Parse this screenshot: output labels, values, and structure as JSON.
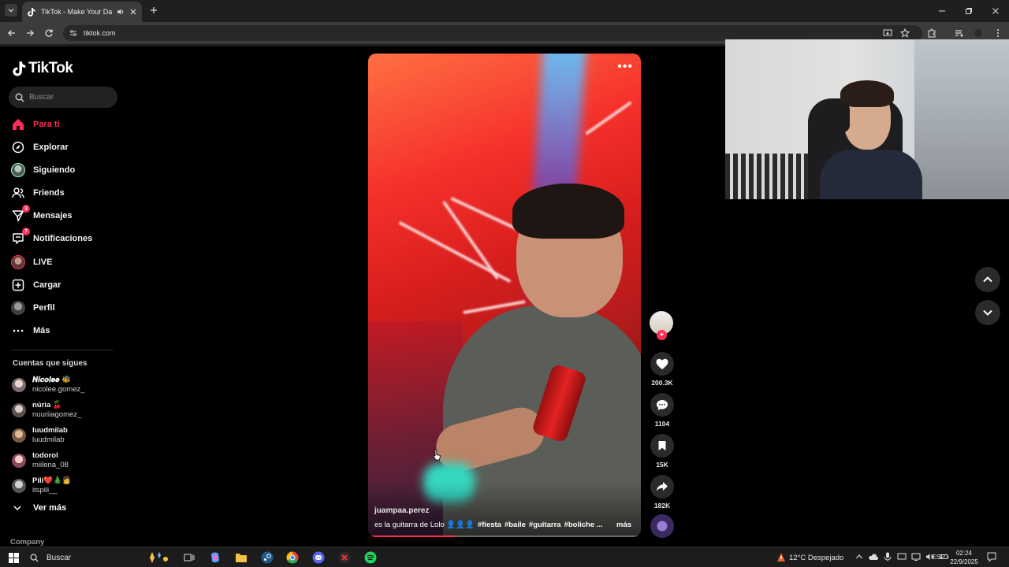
{
  "browser": {
    "tab_title": "TikTok - Make Your Day",
    "url": "tiktok.com"
  },
  "tiktok": {
    "brand": "TikTok",
    "search_placeholder": "Buscar",
    "menu": [
      {
        "label": "Para ti",
        "icon": "home-icon",
        "active": true
      },
      {
        "label": "Explorar",
        "icon": "compass-icon"
      },
      {
        "label": "Siguiendo",
        "icon": "following-avatar-icon"
      },
      {
        "label": "Friends",
        "icon": "friends-icon"
      },
      {
        "label": "Mensajes",
        "icon": "inbox-icon",
        "badge": "3"
      },
      {
        "label": "Notificaciones",
        "icon": "notification-icon",
        "badge": "7"
      },
      {
        "label": "LIVE",
        "icon": "live-avatar-icon"
      },
      {
        "label": "Cargar",
        "icon": "upload-plus-icon"
      },
      {
        "label": "Perfil",
        "icon": "profile-avatar-icon"
      },
      {
        "label": "Más",
        "icon": "more-dots-icon"
      }
    ],
    "following_title": "Cuentas que sigues",
    "following": [
      {
        "name": "𝑵𝒊𝒄𝒐𝒍𝒆𝒆 🐝",
        "handle": "nicolee.gomez_"
      },
      {
        "name": "núria 🍒",
        "handle": "nuuriiagomez_"
      },
      {
        "name": "luudmilab",
        "handle": "luudmilab"
      },
      {
        "name": "todorol",
        "handle": "miilena_08"
      },
      {
        "name": "Pili❤️🎄👩",
        "handle": "itspili__"
      }
    ],
    "see_more": "Ver más",
    "company": "Company"
  },
  "video": {
    "author": "juampaa.perez",
    "caption_text": "es la guitarra de Lolo 👤👤👤",
    "hashtags": [
      "#fiesta",
      "#baile",
      "#guitarra",
      "#boliche ..."
    ],
    "more_label": "más",
    "options_glyph": "•••",
    "progress": 0.32,
    "likes": "200.3K",
    "comments": "1104",
    "saves": "15K",
    "shares": "182K"
  },
  "taskbar": {
    "search_label": "Buscar",
    "weather": "12°C  Despejado",
    "language": "ESP",
    "time": "02:24",
    "date": "22/9/2025"
  },
  "colors": {
    "accent": "#fe2c55",
    "background": "#000000"
  }
}
